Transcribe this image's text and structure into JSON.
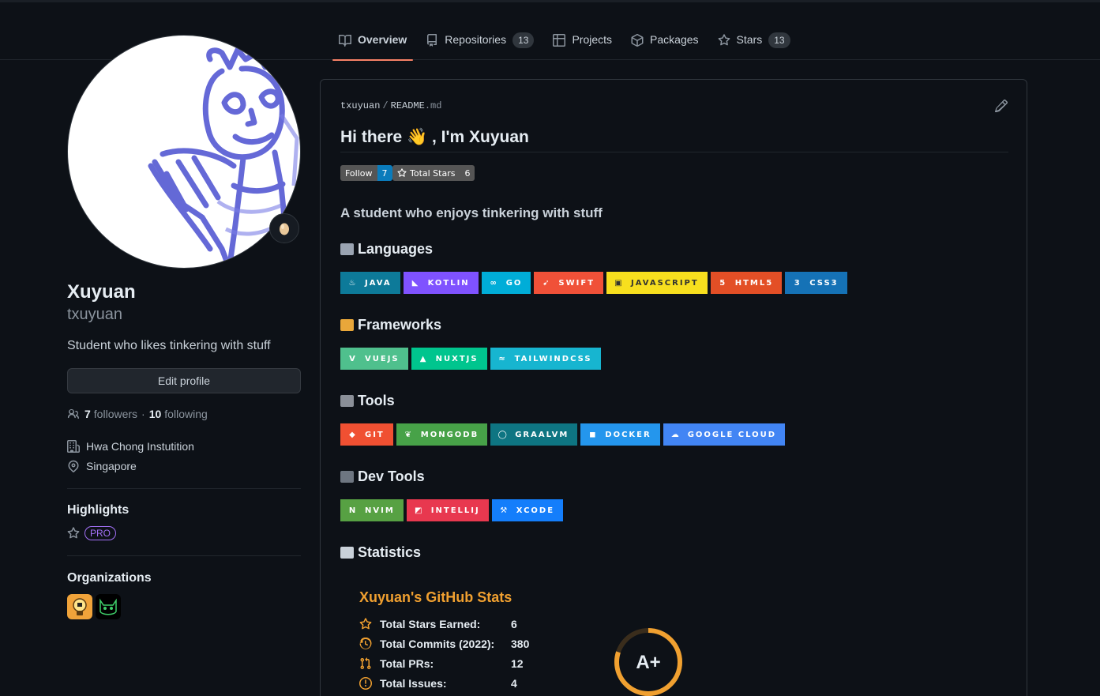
{
  "nav": {
    "tabs": [
      {
        "label": "Overview",
        "icon": "book-icon",
        "active": true
      },
      {
        "label": "Repositories",
        "count": "13",
        "icon": "repo-icon"
      },
      {
        "label": "Projects",
        "icon": "table-icon"
      },
      {
        "label": "Packages",
        "icon": "package-icon"
      },
      {
        "label": "Stars",
        "count": "13",
        "icon": "star-icon"
      }
    ]
  },
  "profile": {
    "name": "Xuyuan",
    "login": "txuyuan",
    "bio": "Student who likes tinkering with stuff",
    "status_emoji": "egg",
    "edit_label": "Edit profile",
    "followers_count": "7",
    "followers_label": "followers",
    "separator": "·",
    "following_count": "10",
    "following_label": "following",
    "organization": "Hwa Chong Instutition",
    "location": "Singapore",
    "highlights_title": "Highlights",
    "pro_label": "PRO",
    "orgs_title": "Organizations"
  },
  "readme": {
    "owner": "txuyuan",
    "slash": "/",
    "file": "README",
    "ext": ".md",
    "heading": "Hi there 👋 , I'm Xuyuan",
    "follow_badge": {
      "label": "Follow",
      "value": "7"
    },
    "stars_badge": {
      "label": "Total Stars",
      "value": "6"
    },
    "subtitle": "A student who enjoys tinkering with stuff",
    "sections": {
      "languages": "Languages",
      "frameworks": "Frameworks",
      "tools": "Tools",
      "devtools": "Dev Tools",
      "statistics": "Statistics"
    },
    "languages": [
      {
        "label": "JAVA",
        "color": "#0d7a99",
        "icon": "java-icon"
      },
      {
        "label": "KOTLIN",
        "color": "#7f52ff",
        "icon": "kotlin-icon"
      },
      {
        "label": "GO",
        "color": "#00add8",
        "icon": "go-icon"
      },
      {
        "label": "SWIFT",
        "color": "#f05138",
        "icon": "swift-icon"
      },
      {
        "label": "JAVASCRIPT",
        "color": "#f7df1e",
        "text": "#323330",
        "icon": "javascript-icon"
      },
      {
        "label": "HTML5",
        "color": "#e34f26",
        "icon": "html5-icon"
      },
      {
        "label": "CSS3",
        "color": "#1572b6",
        "icon": "css3-icon"
      }
    ],
    "frameworks": [
      {
        "label": "VUEJS",
        "color": "#4fc08d",
        "icon": "vue-icon"
      },
      {
        "label": "NUXTJS",
        "color": "#00c58e",
        "icon": "nuxt-icon"
      },
      {
        "label": "TAILWINDCSS",
        "color": "#17b5d0",
        "icon": "tailwind-icon"
      }
    ],
    "tools": [
      {
        "label": "GIT",
        "color": "#f05032",
        "icon": "git-icon"
      },
      {
        "label": "MONGODB",
        "color": "#47a248",
        "icon": "mongodb-icon"
      },
      {
        "label": "GRAALVM",
        "color": "#0e7582",
        "icon": "graalvm-icon"
      },
      {
        "label": "DOCKER",
        "color": "#2496ed",
        "icon": "docker-icon"
      },
      {
        "label": "GOOGLE CLOUD",
        "color": "#4285f4",
        "icon": "google-cloud-icon"
      }
    ],
    "devtools": [
      {
        "label": "NVIM",
        "color": "#57a143",
        "icon": "neovim-icon"
      },
      {
        "label": "INTELLIJ",
        "color": "#e8384f",
        "icon": "intellij-icon"
      },
      {
        "label": "XCODE",
        "color": "#147efb",
        "icon": "xcode-icon"
      }
    ],
    "stats": {
      "title": "Xuyuan's GitHub Stats",
      "rows": [
        {
          "label": "Total Stars Earned:",
          "value": "6",
          "icon": "star-icon"
        },
        {
          "label": "Total Commits (2022):",
          "value": "380",
          "icon": "history-icon"
        },
        {
          "label": "Total PRs:",
          "value": "12",
          "icon": "pull-request-icon"
        },
        {
          "label": "Total Issues:",
          "value": "4",
          "icon": "issue-icon"
        }
      ],
      "grade": "A+",
      "grade_progress": 0.8,
      "accent": "#f0a030"
    }
  },
  "colors": {
    "bg": "#0d1117",
    "accent_tab": "#f78166",
    "stats_orange": "#f0a030"
  }
}
